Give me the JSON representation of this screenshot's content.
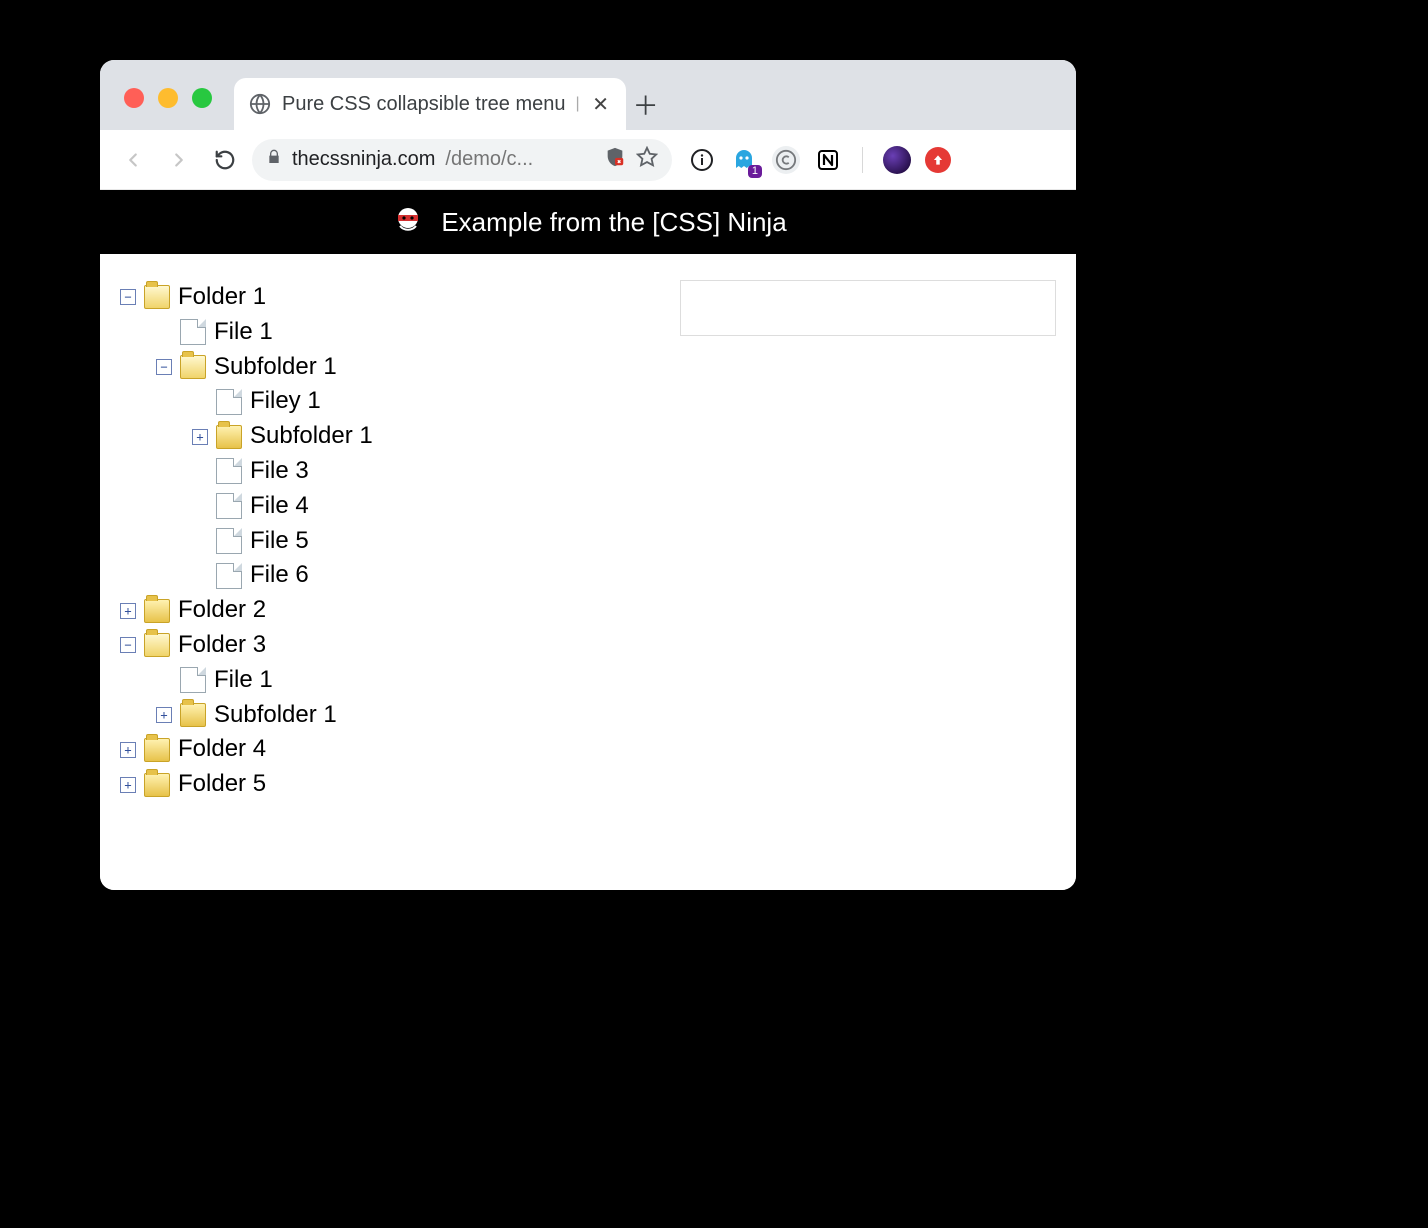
{
  "browser": {
    "tab_title": "Pure CSS collapsible tree menu",
    "url_host": "thecssninja.com",
    "url_path": "/demo/c...",
    "ghost_badge": "1"
  },
  "page": {
    "header_text": "Example from the [CSS] Ninja"
  },
  "tree": [
    {
      "type": "folder",
      "label": "Folder 1",
      "expanded": true,
      "children": [
        {
          "type": "file",
          "label": "File 1"
        },
        {
          "type": "folder",
          "label": "Subfolder 1",
          "expanded": true,
          "children": [
            {
              "type": "file",
              "label": "Filey 1"
            },
            {
              "type": "folder",
              "label": "Subfolder 1",
              "expanded": false,
              "children": []
            },
            {
              "type": "file",
              "label": "File 3"
            },
            {
              "type": "file",
              "label": "File 4"
            },
            {
              "type": "file",
              "label": "File 5"
            },
            {
              "type": "file",
              "label": "File 6"
            }
          ]
        }
      ]
    },
    {
      "type": "folder",
      "label": "Folder 2",
      "expanded": false,
      "children": []
    },
    {
      "type": "folder",
      "label": "Folder 3",
      "expanded": true,
      "children": [
        {
          "type": "file",
          "label": "File 1"
        },
        {
          "type": "folder",
          "label": "Subfolder 1",
          "expanded": false,
          "children": []
        }
      ]
    },
    {
      "type": "folder",
      "label": "Folder 4",
      "expanded": false,
      "children": []
    },
    {
      "type": "folder",
      "label": "Folder 5",
      "expanded": false,
      "children": []
    }
  ]
}
